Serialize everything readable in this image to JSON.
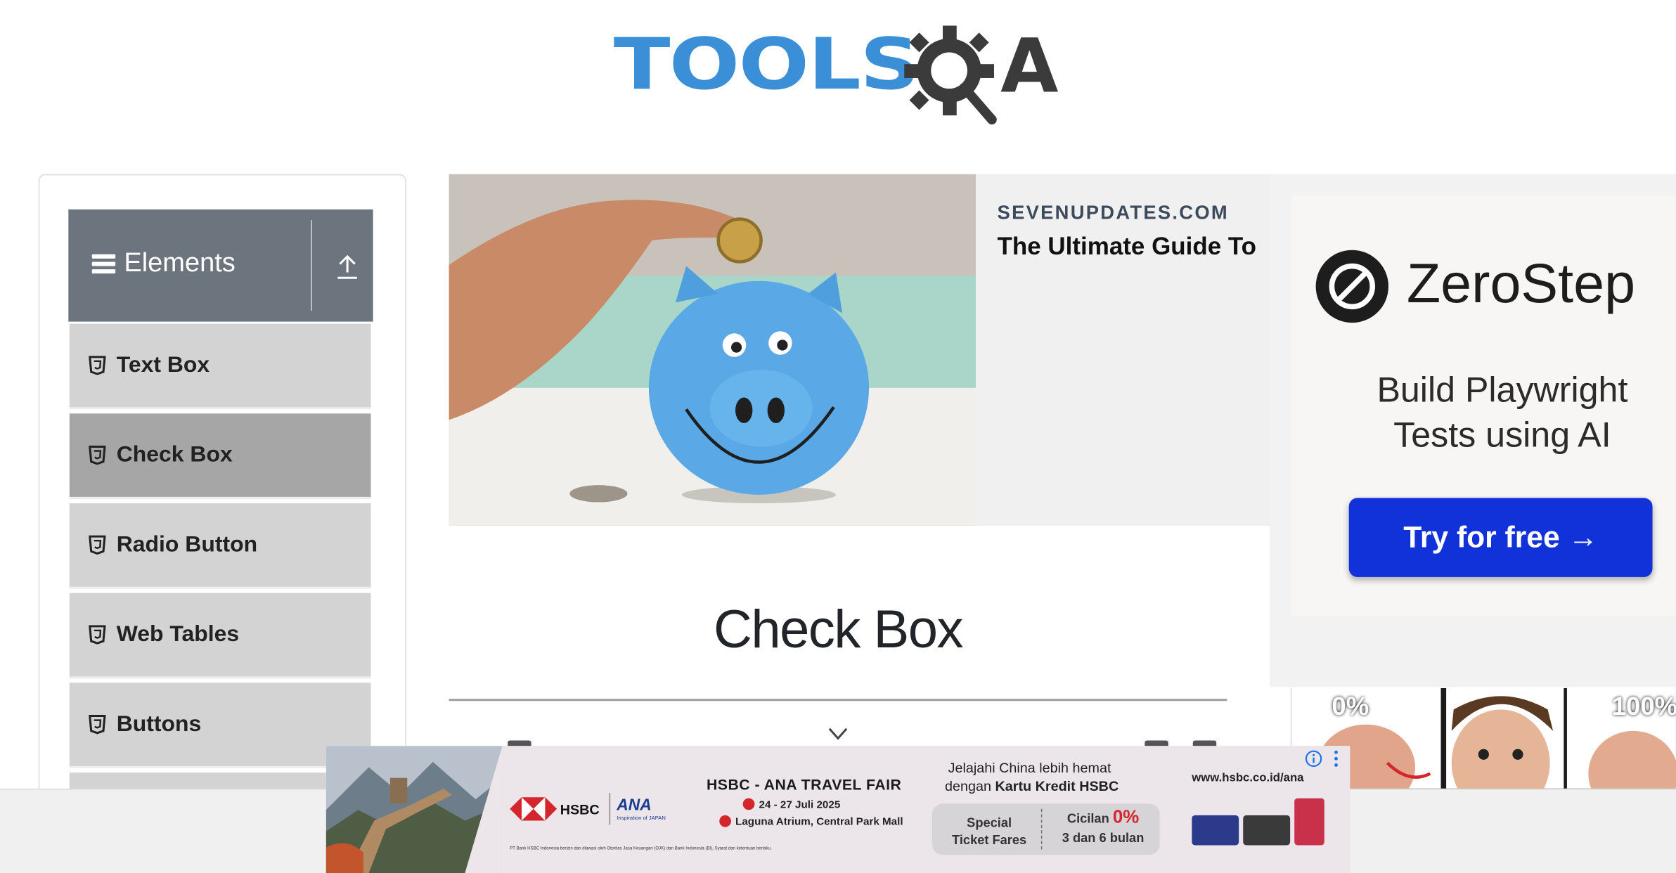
{
  "header": {
    "logo_text_tools": "TOOLS",
    "logo_text_a": "A",
    "logo_icon": "gear-magnifier-icon"
  },
  "sidebar": {
    "group_title": "Elements",
    "group_icons": [
      "hamburger-icon",
      "collapse-up-icon"
    ],
    "items": [
      {
        "label": "Text Box",
        "icon": "html5-icon",
        "active": false
      },
      {
        "label": "Check Box",
        "icon": "html5-icon",
        "active": true
      },
      {
        "label": "Radio Button",
        "icon": "html5-icon",
        "active": false
      },
      {
        "label": "Web Tables",
        "icon": "html5-icon",
        "active": false
      },
      {
        "label": "Buttons",
        "icon": "html5-icon",
        "active": false
      }
    ]
  },
  "ad_top": {
    "domain": "SEVENUPDATES.COM",
    "headline": "The Ultimate Guide To"
  },
  "main": {
    "page_title": "Check Box"
  },
  "ad_right": {
    "brand": "ZeroStep",
    "tagline_line1": "Build Playwright",
    "tagline_line2": "Tests using AI",
    "cta": "Try for free →",
    "video_labels": [
      "0%",
      "100%"
    ]
  },
  "banner": {
    "hsbc": "HSBC",
    "ana": "ANA",
    "ana_sub": "Inspiration of JAPAN",
    "title": "HSBC - ANA TRAVEL FAIR",
    "date": "24 - 27 Juli 2025",
    "location": "Laguna Atrium, Central Park Mall",
    "tagline_line1": "Jelajahi China lebih hemat",
    "tagline_line2_prefix": "dengan",
    "tagline_line2_bold": "Kartu Kredit HSBC",
    "offer_a_line1": "Special",
    "offer_a_line2": "Ticket Fares",
    "offer_b_prefix": "Cicilan",
    "offer_b_pct": "0%",
    "offer_b_line2": "3 dan 6 bulan",
    "url": "www.hsbc.co.id/ana",
    "fine_print": "PT Bank HSBC Indonesia berizin dan diawasi oleh Otoritas Jasa Keuangan (OJK) dan Bank Indonesia (BI), Syarat dan ketentuan berlaku."
  },
  "colors": {
    "logo_blue": "#3a8fd6",
    "logo_dark": "#3b3b3b",
    "menu_header": "#6c757d",
    "menu_item": "#d3d3d3",
    "menu_item_active": "#a6a6a6",
    "cta_blue": "#1132d8",
    "hsbc_red": "#d3272d"
  }
}
